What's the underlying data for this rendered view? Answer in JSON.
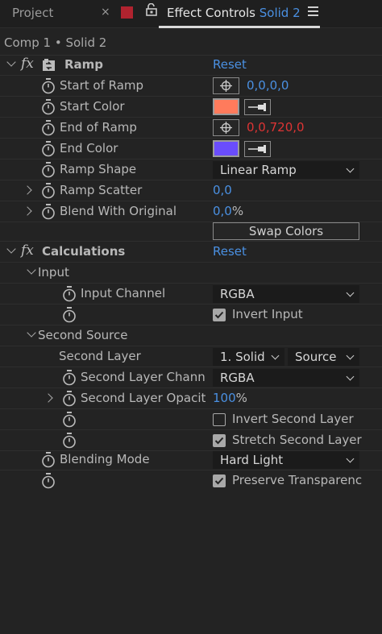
{
  "tabs": {
    "project": "Project",
    "close": "×",
    "effect_controls_prefix": "Effect Controls",
    "layer_name": "Solid 2"
  },
  "comp_path": "Comp 1 • Solid 2",
  "ramp": {
    "name": "Ramp",
    "reset": "Reset",
    "start_of_ramp": {
      "label": "Start of Ramp",
      "value": "0,0,0,0"
    },
    "start_color": {
      "label": "Start Color",
      "color": "#ff7b5c"
    },
    "end_of_ramp": {
      "label": "End of Ramp",
      "value": "0,0,720,0"
    },
    "end_color": {
      "label": "End Color",
      "color": "#6a4dfc"
    },
    "ramp_shape": {
      "label": "Ramp Shape",
      "value": "Linear Ramp"
    },
    "ramp_scatter": {
      "label": "Ramp Scatter",
      "value": "0,0"
    },
    "blend_with_original": {
      "label": "Blend With Original",
      "value": "0,0",
      "unit": "%"
    },
    "swap_colors": "Swap Colors"
  },
  "calculations": {
    "name": "Calculations",
    "reset": "Reset",
    "input_group": "Input",
    "input_channel": {
      "label": "Input Channel",
      "value": "RGBA"
    },
    "invert_input": {
      "label": "Invert Input",
      "checked": true
    },
    "second_source_group": "Second Source",
    "second_layer": {
      "label": "Second Layer",
      "value": "1. Solid",
      "source": "Source"
    },
    "second_layer_channel": {
      "label": "Second Layer Chann",
      "value": "RGBA"
    },
    "second_layer_opacity": {
      "label": "Second Layer Opacit",
      "value": "100",
      "unit": "%"
    },
    "invert_second_layer": {
      "label": "Invert Second Layer",
      "checked": false
    },
    "stretch_second_layer": {
      "label": "Stretch Second Layer",
      "checked": true
    },
    "blending_mode": {
      "label": "Blending Mode",
      "value": "Hard Light"
    },
    "preserve_transparency": {
      "label": "Preserve Transparenc",
      "checked": true
    }
  }
}
